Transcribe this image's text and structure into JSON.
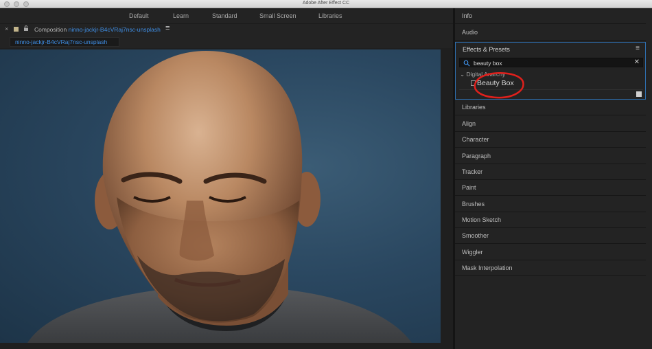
{
  "window": {
    "title": "Adobe After Effect CC"
  },
  "workspaces": [
    "Default",
    "Learn",
    "Standard",
    "Small Screen",
    "Libraries"
  ],
  "composition": {
    "label_prefix": "Composition",
    "name": "ninno-jackjr-B4cVRaj7nsc-unsplash",
    "tab_name": "ninno-jackjr-B4cVRaj7nsc-unsplash",
    "close_glyph": "×",
    "menu_glyph": "≡"
  },
  "panels": {
    "info": "Info",
    "audio": "Audio",
    "effects": {
      "title": "Effects & Presets",
      "menu_glyph": "≡",
      "search_value": "beauty box",
      "clear_glyph": "✕",
      "group": "Digital Anarchy",
      "effect": "Beauty Box"
    },
    "below": [
      "Libraries",
      "Align",
      "Character",
      "Paragraph",
      "Tracker",
      "Paint",
      "Brushes",
      "Motion Sketch",
      "Smoother",
      "Wiggler",
      "Mask Interpolation"
    ]
  },
  "colors": {
    "accent": "#3f8fe6",
    "highlight_border": "#2e6fb0",
    "annotation": "#e0201c",
    "panel_bg": "#232323"
  },
  "icons": {
    "search": "search-icon",
    "lock": "lock-icon",
    "close": "close-icon",
    "new_bin": "new-bin-icon"
  }
}
